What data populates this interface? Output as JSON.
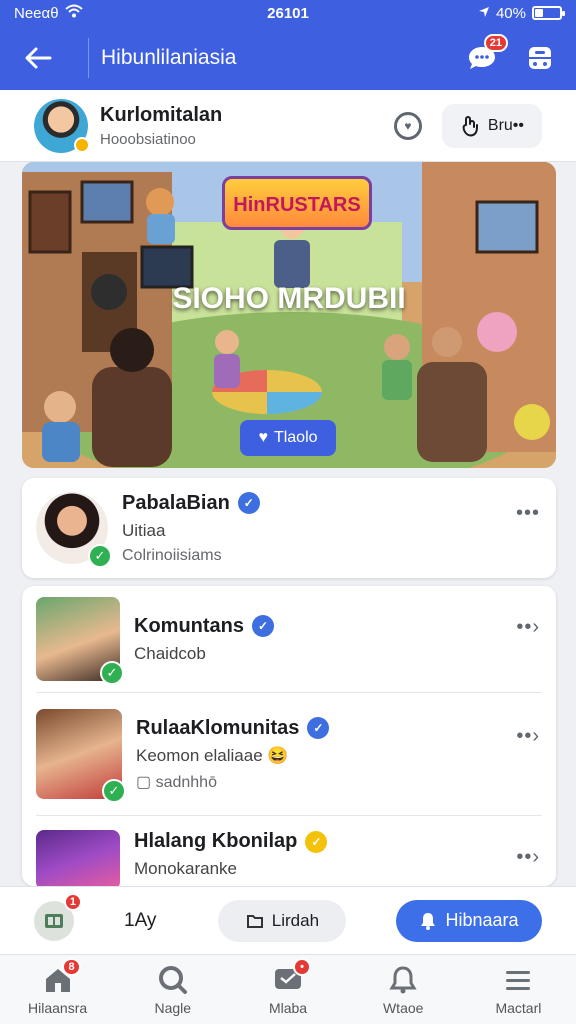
{
  "status": {
    "carrier": "Neeαθ",
    "time": "26101",
    "battery": "40%",
    "battery_level": 0.4
  },
  "appbar": {
    "title": "Hibunlilaniasia",
    "notif_count": "21"
  },
  "profile": {
    "name": "Kurlomitalan",
    "subtitle": "Hooobsiatinoo",
    "action_label": "Bru••"
  },
  "hero": {
    "logo_text": "HinRUSTARS",
    "title": "SIOHO MRDUBII",
    "cta_label": "Tlaolo"
  },
  "items": [
    {
      "title": "PabalaBian",
      "line1": "Uitiaa",
      "line2": "Colrinoiisiams",
      "badge": "blue"
    },
    {
      "title": "Komuntans",
      "line1": "Chaidcob",
      "badge": "blue"
    },
    {
      "title": "RulaaKlomunitas",
      "line1": "Keomon elaliaae",
      "line2": "sadnhhō",
      "badge": "blue"
    },
    {
      "title": "Hlalang Kbonilap",
      "line1": "Monokaranke",
      "badge": "gold"
    }
  ],
  "bottom_action": {
    "badge": "1",
    "count": "1Ay",
    "secondary_label": "Lirdah",
    "primary_label": "Hibnaara"
  },
  "tabs": [
    {
      "label": "Hilaansra",
      "icon": "home-icon",
      "badge": "8"
    },
    {
      "label": "Nagle",
      "icon": "search-icon"
    },
    {
      "label": "Mlaba",
      "icon": "messages-icon",
      "badge": "•"
    },
    {
      "label": "Wtaoe",
      "icon": "bell-icon"
    },
    {
      "label": "Mactarl",
      "icon": "menu-icon"
    }
  ]
}
